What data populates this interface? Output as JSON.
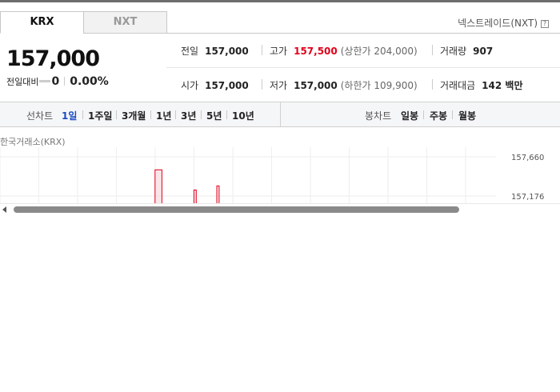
{
  "tabs": {
    "krx": "KRX",
    "nxt": "NXT"
  },
  "nxt_link": {
    "label": "넥스트레이드(NXT)",
    "help_icon": "?"
  },
  "price": {
    "current": "157,000",
    "change_label": "전일대비",
    "change_value": "0",
    "change_rate": "0.00%"
  },
  "stats": {
    "prev_close": {
      "label": "전일",
      "value": "157,000"
    },
    "high": {
      "label": "고가",
      "value": "157,500",
      "limit_text": "(상한가 204,000)"
    },
    "volume": {
      "label": "거래량",
      "value": "907"
    },
    "open": {
      "label": "시가",
      "value": "157,000"
    },
    "low": {
      "label": "저가",
      "value": "157,000",
      "limit_text": "(하한가 109,900)"
    },
    "amount": {
      "label": "거래대금",
      "value": "142 백만"
    }
  },
  "chart_controls": {
    "line_label": "선차트",
    "line_periods": [
      "1일",
      "1주일",
      "3개월",
      "1년",
      "3년",
      "5년",
      "10년"
    ],
    "active": "1일",
    "candle_label": "봉차트",
    "candle_periods": [
      "일봉",
      "주봉",
      "월봉"
    ]
  },
  "market_label": "한국거래소(KRX)",
  "chart_data": {
    "type": "line",
    "title": "",
    "y_ticks": [
      "157,660",
      "157,176"
    ],
    "ylim": [
      156692,
      157660
    ],
    "x": [
      0,
      10,
      20,
      30,
      40,
      50,
      60,
      65,
      66,
      67,
      68,
      69,
      70,
      71,
      72,
      80,
      82,
      83,
      84,
      90,
      92,
      93,
      94,
      100,
      105,
      106,
      107,
      110,
      115,
      116,
      117,
      120,
      125,
      126,
      127,
      140,
      150,
      155,
      160,
      170,
      180,
      190,
      200,
      210,
      215
    ],
    "values": [
      157000,
      157000,
      157000,
      157000,
      157000,
      157000,
      157000,
      157000,
      157500,
      157500,
      157500,
      157000,
      157000,
      157000,
      157000,
      157000,
      157000,
      157250,
      157000,
      157000,
      157000,
      157300,
      157000,
      157000,
      157000,
      157000,
      157000,
      157000,
      157000,
      157000,
      157000,
      157000,
      157000,
      157000,
      157000,
      157000,
      157000,
      157000,
      157000,
      157000,
      157000,
      157000,
      157000,
      157000,
      157000
    ],
    "grid": true,
    "color": "#e0001a",
    "fill_color": "#f5c6cb"
  }
}
